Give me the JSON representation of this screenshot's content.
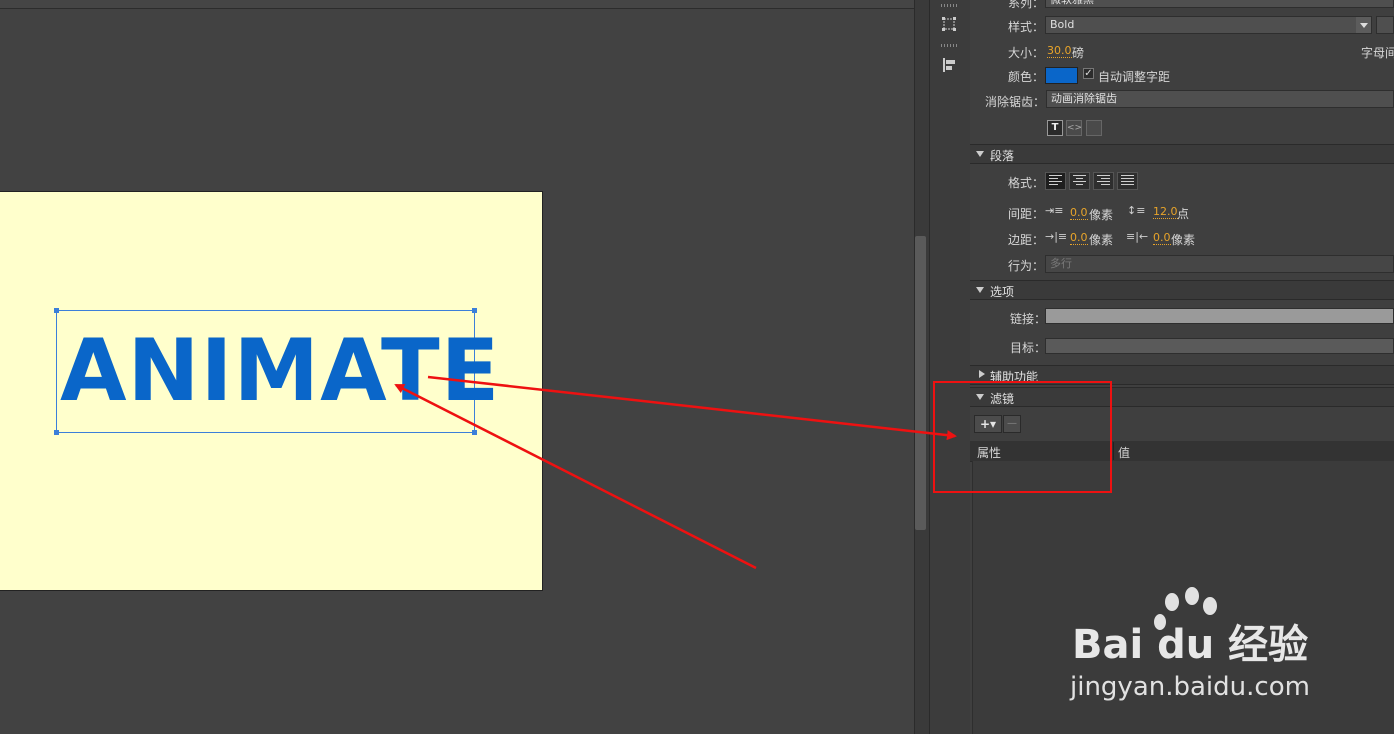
{
  "stage": {
    "text_object": "ANIMATE",
    "text_color": "#0a66c9",
    "canvas_color": "#ffffcc"
  },
  "character": {
    "family_label": "系列：",
    "family_value": "微软雅黑",
    "style_label": "样式：",
    "style_value": "Bold",
    "size_label": "大小：",
    "size_value": "30.0",
    "size_unit": "磅",
    "letter_spacing_label": "字母间",
    "color_label": "颜色：",
    "color_value": "#0a66c9",
    "auto_kern_label": "自动调整字距",
    "antialias_label": "消除锯齿：",
    "antialias_value": "动画消除锯齿"
  },
  "paragraph": {
    "section_title": "段落",
    "format_label": "格式：",
    "spacing_label": "间距：",
    "spacing_indent_value": "0.0",
    "spacing_indent_unit": "像素",
    "spacing_line_value": "12.0",
    "spacing_line_unit": "点",
    "margin_label": "边距：",
    "margin_left_value": "0.0",
    "margin_left_unit": "像素",
    "margin_right_value": "0.0",
    "margin_right_unit": "像素",
    "behavior_label": "行为：",
    "behavior_value": "多行"
  },
  "options": {
    "section_title": "选项",
    "link_label": "链接：",
    "target_label": "目标："
  },
  "accessibility": {
    "section_title": "辅助功能"
  },
  "filters": {
    "section_title": "滤镜",
    "add_label": "+▾",
    "remove_label": "—",
    "col_property": "属性",
    "col_value": "值"
  },
  "watermark": {
    "logo": "Bai du 经验",
    "url": "jingyan.baidu.com"
  }
}
